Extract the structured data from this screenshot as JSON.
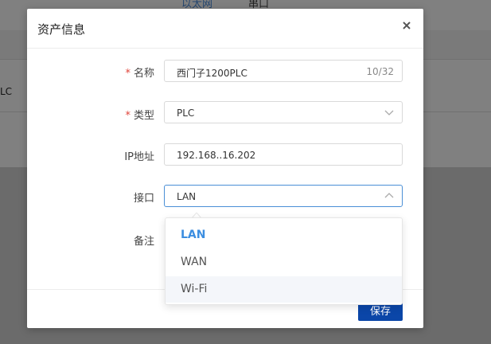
{
  "background": {
    "tabs": [
      "以太网",
      "串口"
    ],
    "cell_text": "LC"
  },
  "dialog": {
    "title": "资产信息",
    "close_label": "×",
    "save_label": "保存"
  },
  "form": {
    "name": {
      "label": "名称",
      "required_mark": "*",
      "value": "西门子1200PLC",
      "count": "10/32"
    },
    "type": {
      "label": "类型",
      "required_mark": "*",
      "value": "PLC"
    },
    "ip": {
      "label": "IP地址",
      "value": "192.168..16.202"
    },
    "interface": {
      "label": "接口",
      "value": "LAN"
    },
    "note": {
      "label": "备注"
    }
  },
  "dropdown": {
    "options": [
      "LAN",
      "WAN",
      "Wi-Fi"
    ],
    "selected": "LAN",
    "hovered": "Wi-Fi"
  },
  "colors": {
    "accent": "#3c8ee0",
    "primary_button": "#0b46a8",
    "required": "#e0443a"
  }
}
